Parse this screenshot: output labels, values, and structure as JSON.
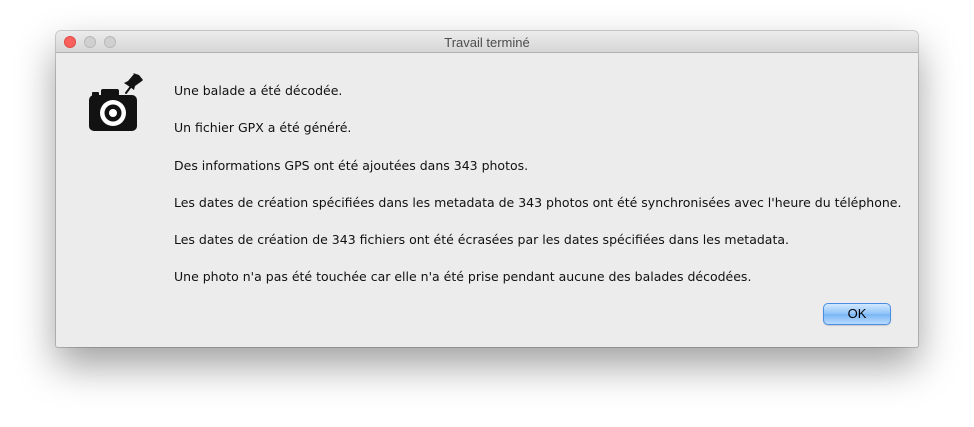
{
  "window": {
    "title": "Travail terminé"
  },
  "dialog": {
    "icon": "camera-pin-icon",
    "messages": [
      "Une balade a été décodée.",
      "Un fichier GPX a été généré.",
      "Des informations GPS ont été ajoutées dans 343 photos.",
      "Les dates de création spécifiées dans les metadata de 343 photos ont été synchronisées avec l'heure du téléphone.",
      "Les dates de création de 343 fichiers ont été écrasées par les dates spécifiées dans les metadata.",
      "Une photo n'a pas été touchée car elle n'a été prise pendant aucune des balades décodées."
    ],
    "ok_label": "OK"
  },
  "colors": {
    "close_button": "#fc605c",
    "default_button": "#8dc2f7",
    "window_background": "#ececec"
  }
}
